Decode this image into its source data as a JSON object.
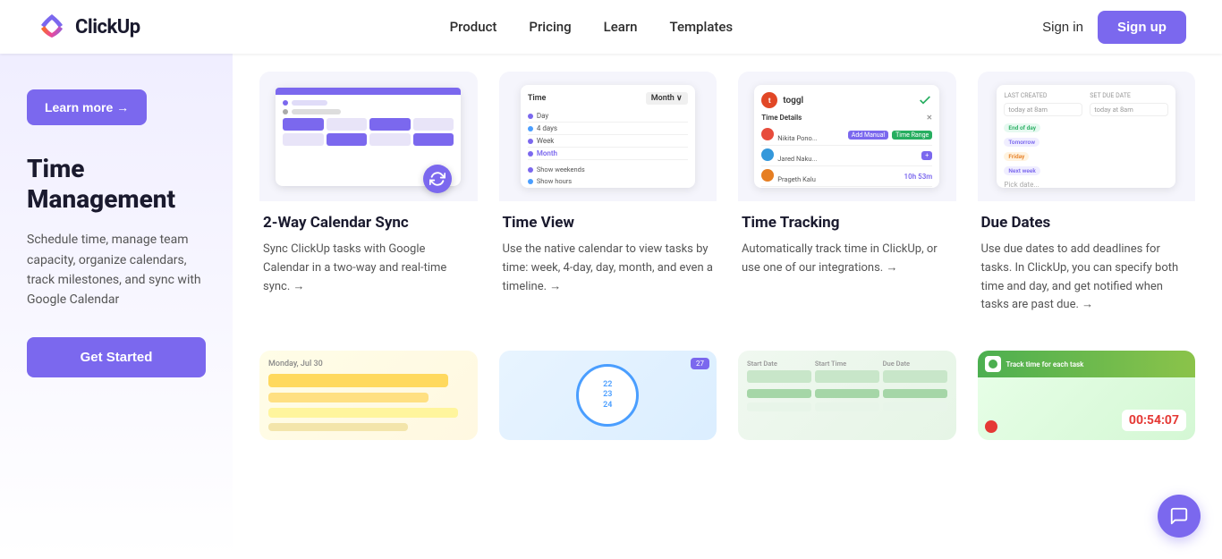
{
  "navbar": {
    "logo_text": "ClickUp",
    "nav_items": [
      {
        "label": "Product",
        "id": "product"
      },
      {
        "label": "Pricing",
        "id": "pricing"
      },
      {
        "label": "Learn",
        "id": "learn"
      },
      {
        "label": "Templates",
        "id": "templates"
      }
    ],
    "signin_label": "Sign in",
    "signup_label": "Sign up"
  },
  "sidebar": {
    "cta_label": "Learn more →",
    "title": "Time Management",
    "description": "Schedule time, manage team capacity, organize calendars, track milestones, and sync with Google Calendar",
    "get_started_label": "Get Started"
  },
  "features": [
    {
      "id": "calendar-sync",
      "title": "2-Way Calendar Sync",
      "description": "Sync ClickUp tasks with Google Calendar in a two-way and real-time sync. →"
    },
    {
      "id": "time-view",
      "title": "Time View",
      "description": "Use the native calendar to view tasks by time: week, 4-day, day, month, and even a timeline. →"
    },
    {
      "id": "time-tracking",
      "title": "Time Tracking",
      "description": "Automatically track time in ClickUp, or use one of our integrations. →"
    },
    {
      "id": "due-dates",
      "title": "Due Dates",
      "description": "Use due dates to add deadlines for tasks. In ClickUp, you can specify both time and day, and get notified when tasks are past due. →"
    }
  ],
  "bottom_features": [
    {
      "id": "box-feature-1"
    },
    {
      "id": "box-feature-2"
    },
    {
      "id": "box-feature-3"
    },
    {
      "id": "box-feature-4"
    }
  ]
}
